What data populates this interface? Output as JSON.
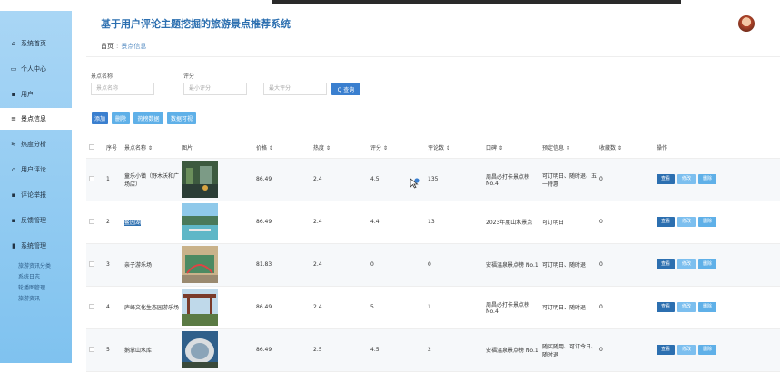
{
  "app": {
    "title": "基于用户评论主题挖掘的旅游景点推荐系统"
  },
  "breadcrumb": {
    "home": "首页",
    "sep": ":",
    "current": "景点信息"
  },
  "sidebar": {
    "items": [
      {
        "label": "系统首页",
        "icon": "home-icon",
        "glyph": "⌂"
      },
      {
        "label": "个人中心",
        "icon": "user-card-icon",
        "glyph": "▭"
      },
      {
        "label": "用户",
        "icon": "grid-icon",
        "glyph": "▪▪"
      },
      {
        "label": "景点信息",
        "icon": "list-icon",
        "glyph": "≡"
      },
      {
        "label": "热度分析",
        "icon": "sliders-icon",
        "glyph": "⚟"
      },
      {
        "label": "用户评论",
        "icon": "home-small-icon",
        "glyph": "⌂"
      },
      {
        "label": "评论举报",
        "icon": "grid-icon",
        "glyph": "▪▪"
      },
      {
        "label": "反馈管理",
        "icon": "grid-icon",
        "glyph": "▪▪"
      },
      {
        "label": "系统管理",
        "icon": "chart-icon",
        "glyph": "▮"
      }
    ],
    "subitems": [
      "旅游资讯分类",
      "系统日志",
      "轮播图管理",
      "旅游资讯"
    ]
  },
  "filters": {
    "name_label": "景点名称",
    "name_placeholder": "景点名称",
    "score_label": "评分",
    "min_placeholder": "最小评分",
    "max_placeholder": "最大评分",
    "search_label": "Q 查询"
  },
  "toolbar": {
    "add": "添加",
    "delete": "删除",
    "hot_data": "热榜数据",
    "data_analysis": "数据可视"
  },
  "table": {
    "headers": {
      "index": "序号",
      "name": "景点名称 ⇕",
      "image": "图片",
      "price": "价格 ⇕",
      "heat": "热度 ⇕",
      "score": "评分 ⇕",
      "reviews": "评论数 ⇕",
      "tag": "口碑 ⇕",
      "booking": "预定信息 ⇕",
      "favorites": "收藏数 ⇕",
      "actions": "操作"
    },
    "rows": [
      {
        "index": "1",
        "name": "童乐小镇（野木沃和广场店）",
        "image": "photo-1",
        "price": "86.49",
        "heat": "2.4",
        "score": "4.5",
        "reviews": "135",
        "tag": "周昌必打卡景点榜 No.4",
        "booking": "可订明日、随时退、五一特惠",
        "favorites": "0"
      },
      {
        "index": "2",
        "name": "鳌园湖",
        "image": "photo-2",
        "price": "86.49",
        "heat": "2.4",
        "score": "4.4",
        "reviews": "13",
        "tag": "2023年度山水景点",
        "booking": "可订明日",
        "favorites": "0"
      },
      {
        "index": "3",
        "name": "亲子游乐场",
        "image": "photo-3",
        "price": "81.83",
        "heat": "2.4",
        "score": "0",
        "reviews": "0",
        "tag": "安福温泉景点榜 No.1",
        "booking": "可订明日、随时退",
        "favorites": "0"
      },
      {
        "index": "4",
        "name": "庐峰文化生态园游乐场",
        "image": "photo-4",
        "price": "86.49",
        "heat": "2.4",
        "score": "5",
        "reviews": "1",
        "tag": "周昌必打卡景点榜 No.4",
        "booking": "可订明日、随时退",
        "favorites": "0"
      },
      {
        "index": "5",
        "name": "鹅掌山水库",
        "image": "photo-5",
        "price": "86.49",
        "heat": "2.5",
        "score": "4.5",
        "reviews": "2",
        "tag": "安福温泉景点榜 No.1",
        "booking": "随买随用、可订今日、随时退",
        "favorites": "0"
      }
    ],
    "actions": {
      "view": "查看",
      "edit": "修改",
      "delete": "删除"
    }
  },
  "colors": {
    "accent": "#2c6fb0",
    "sidebar": "#a9d6f5",
    "button": "#3a7fcf"
  }
}
